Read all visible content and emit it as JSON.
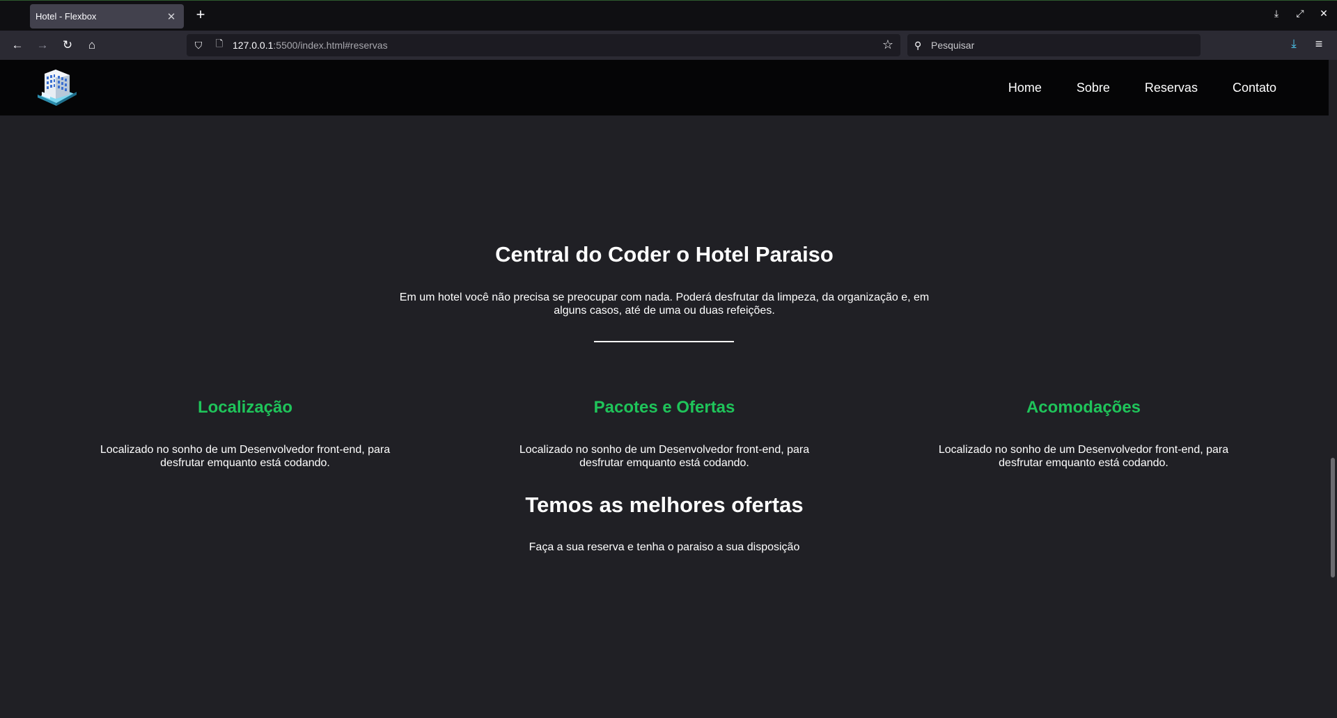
{
  "browser": {
    "tab_title": "Hotel - Flexbox",
    "url_host": "127.0.0.1",
    "url_rest": ":5500/index.html#reservas",
    "search_placeholder": "Pesquisar"
  },
  "site": {
    "nav": [
      "Home",
      "Sobre",
      "Reservas",
      "Contato"
    ],
    "hero_title": "Central do Coder o Hotel Paraiso",
    "hero_text": "Em um hotel você não precisa se preocupar com nada. Poderá desfrutar da limpeza, da organização e, em alguns casos, até de uma ou duas refeições.",
    "features": [
      {
        "title": "Localização",
        "text": "Localizado no sonho de um Desenvolvedor front-end, para desfrutar emquanto está codando."
      },
      {
        "title": "Pacotes e Ofertas",
        "text": "Localizado no sonho de um Desenvolvedor front-end, para desfrutar emquanto está codando."
      },
      {
        "title": "Acomodações",
        "text": "Localizado no sonho de um Desenvolvedor front-end, para desfrutar emquanto está codando."
      }
    ],
    "offer_title": "Temos as melhores ofertas",
    "offer_text": "Faça a sua reserva e tenha o paraiso a sua disposição"
  },
  "colors": {
    "accent_green": "#1fc45a",
    "header_bg": "#050506",
    "page_bg": "#202025"
  }
}
